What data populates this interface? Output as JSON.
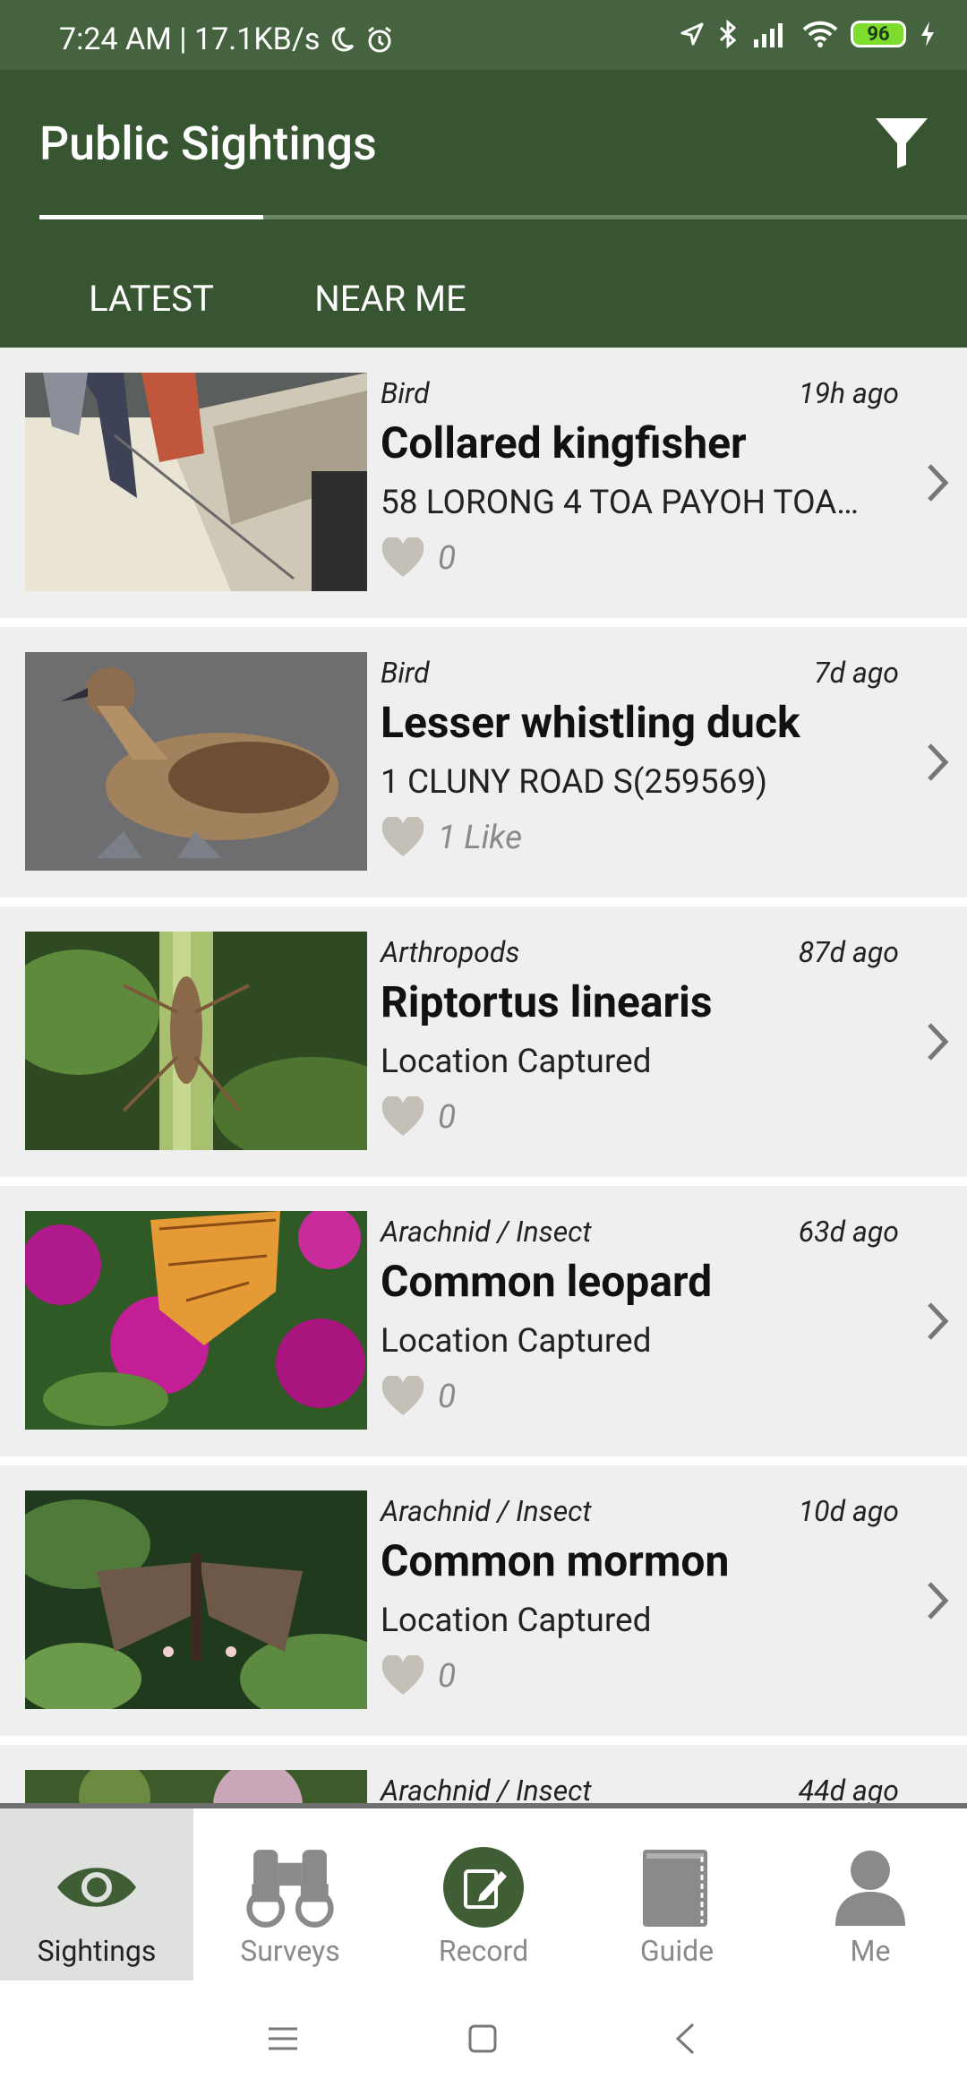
{
  "status_bar": {
    "time": "7:24 AM | 17.1KB/s",
    "battery": "96"
  },
  "header": {
    "title": "Public Sightings",
    "filter_icon": "filter-icon"
  },
  "tabs": [
    {
      "label": "LATEST"
    },
    {
      "label": "NEAR ME"
    }
  ],
  "sightings": [
    {
      "category": "Bird",
      "time_ago": "19h ago",
      "name": "Collared kingfisher",
      "location": "58 LORONG 4 TOA PAYOH TOA…",
      "likes": "0"
    },
    {
      "category": "Bird",
      "time_ago": "7d ago",
      "name": "Lesser whistling duck",
      "location": "1 CLUNY ROAD  S(259569)",
      "likes": "1 Like"
    },
    {
      "category": "Arthropods",
      "time_ago": "87d ago",
      "name": "Riptortus linearis",
      "location": "Location Captured",
      "likes": "0"
    },
    {
      "category": "Arachnid / Insect",
      "time_ago": "63d ago",
      "name": "Common leopard",
      "location": "Location Captured",
      "likes": "0"
    },
    {
      "category": "Arachnid / Insect",
      "time_ago": "10d ago",
      "name": "Common mormon",
      "location": "Location Captured",
      "likes": "0"
    },
    {
      "category": "Arachnid / Insect",
      "time_ago": "44d ago",
      "name": "",
      "location": "",
      "likes": ""
    }
  ],
  "bottom_nav": [
    {
      "label": "Sightings",
      "icon": "eye-icon"
    },
    {
      "label": "Surveys",
      "icon": "binoculars-icon"
    },
    {
      "label": "Record",
      "icon": "record-icon"
    },
    {
      "label": "Guide",
      "icon": "book-icon"
    },
    {
      "label": "Me",
      "icon": "person-icon"
    }
  ],
  "colors": {
    "app_bar": "#375531",
    "status_bar": "#466340",
    "active_nav_bg": "#dfe1de"
  }
}
